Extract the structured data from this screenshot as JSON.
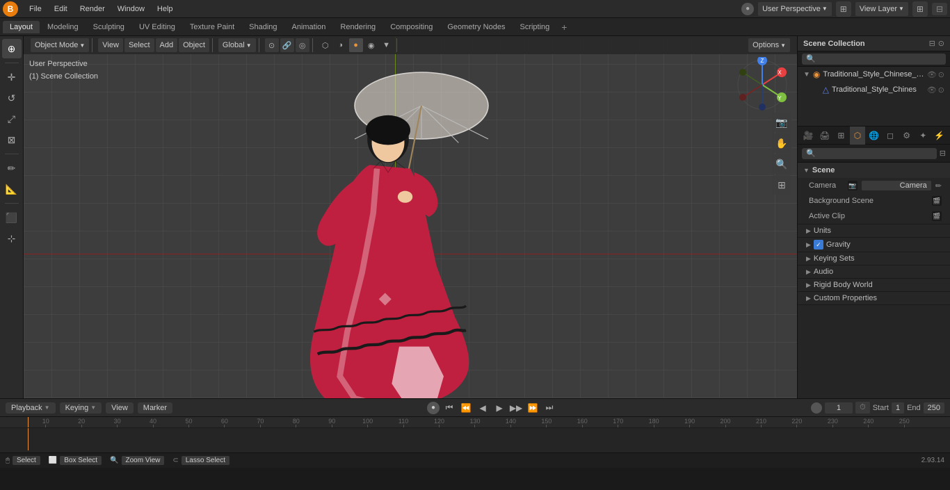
{
  "app": {
    "logo": "B",
    "version": "2.93.14"
  },
  "menu": {
    "items": [
      "File",
      "Edit",
      "Render",
      "Window",
      "Help"
    ]
  },
  "workspace_tabs": {
    "items": [
      "Layout",
      "Modeling",
      "Sculpting",
      "UV Editing",
      "Texture Paint",
      "Shading",
      "Animation",
      "Rendering",
      "Compositing",
      "Geometry Nodes",
      "Scripting"
    ],
    "active": "Layout"
  },
  "viewport_header": {
    "mode": "Object Mode",
    "view": "View",
    "select": "Select",
    "add": "Add",
    "object": "Object",
    "global": "Global",
    "view_perspective": "User Perspective",
    "scene_collection": "(1) Scene Collection"
  },
  "viewport_gizmo": {
    "x_color": "#e84040",
    "y_color": "#80c040",
    "z_color": "#4080e8"
  },
  "right_panel": {
    "outliner_title": "Scene Collection",
    "items": [
      {
        "name": "Traditional_Style_Chinese_Yo",
        "indent": 0,
        "has_children": true
      },
      {
        "name": "Traditional_Style_Chines",
        "indent": 1,
        "has_children": false
      }
    ],
    "props_search_placeholder": "",
    "scene_label": "Scene",
    "properties": {
      "scene_section": {
        "title": "Scene",
        "camera_label": "Camera",
        "camera_value": "Camera",
        "bg_scene_label": "Background Scene",
        "active_clip_label": "Active Clip"
      },
      "units": {
        "title": "Units"
      },
      "gravity": {
        "title": "Gravity",
        "checked": true
      },
      "keying_sets": {
        "title": "Keying Sets"
      },
      "audio": {
        "title": "Audio"
      },
      "rigid_body_world": {
        "title": "Rigid Body World"
      },
      "custom_properties": {
        "title": "Custom Properties"
      }
    }
  },
  "timeline": {
    "playback_label": "Playback",
    "keying_label": "Keying",
    "view_label": "View",
    "marker_label": "Marker",
    "current_frame": "1",
    "start_label": "Start",
    "start_value": "1",
    "end_label": "End",
    "end_value": "250",
    "ruler_marks": [
      "10",
      "20",
      "30",
      "40",
      "50",
      "60",
      "70",
      "80",
      "90",
      "100",
      "110",
      "120",
      "130",
      "140",
      "150",
      "160",
      "170",
      "180",
      "190",
      "200",
      "210",
      "220",
      "230",
      "240",
      "250"
    ]
  },
  "status_bar": {
    "select_label": "Select",
    "box_select_label": "Box Select",
    "zoom_view_label": "Zoom View",
    "lasso_select_label": "Lasso Select",
    "version": "2.93.14"
  }
}
